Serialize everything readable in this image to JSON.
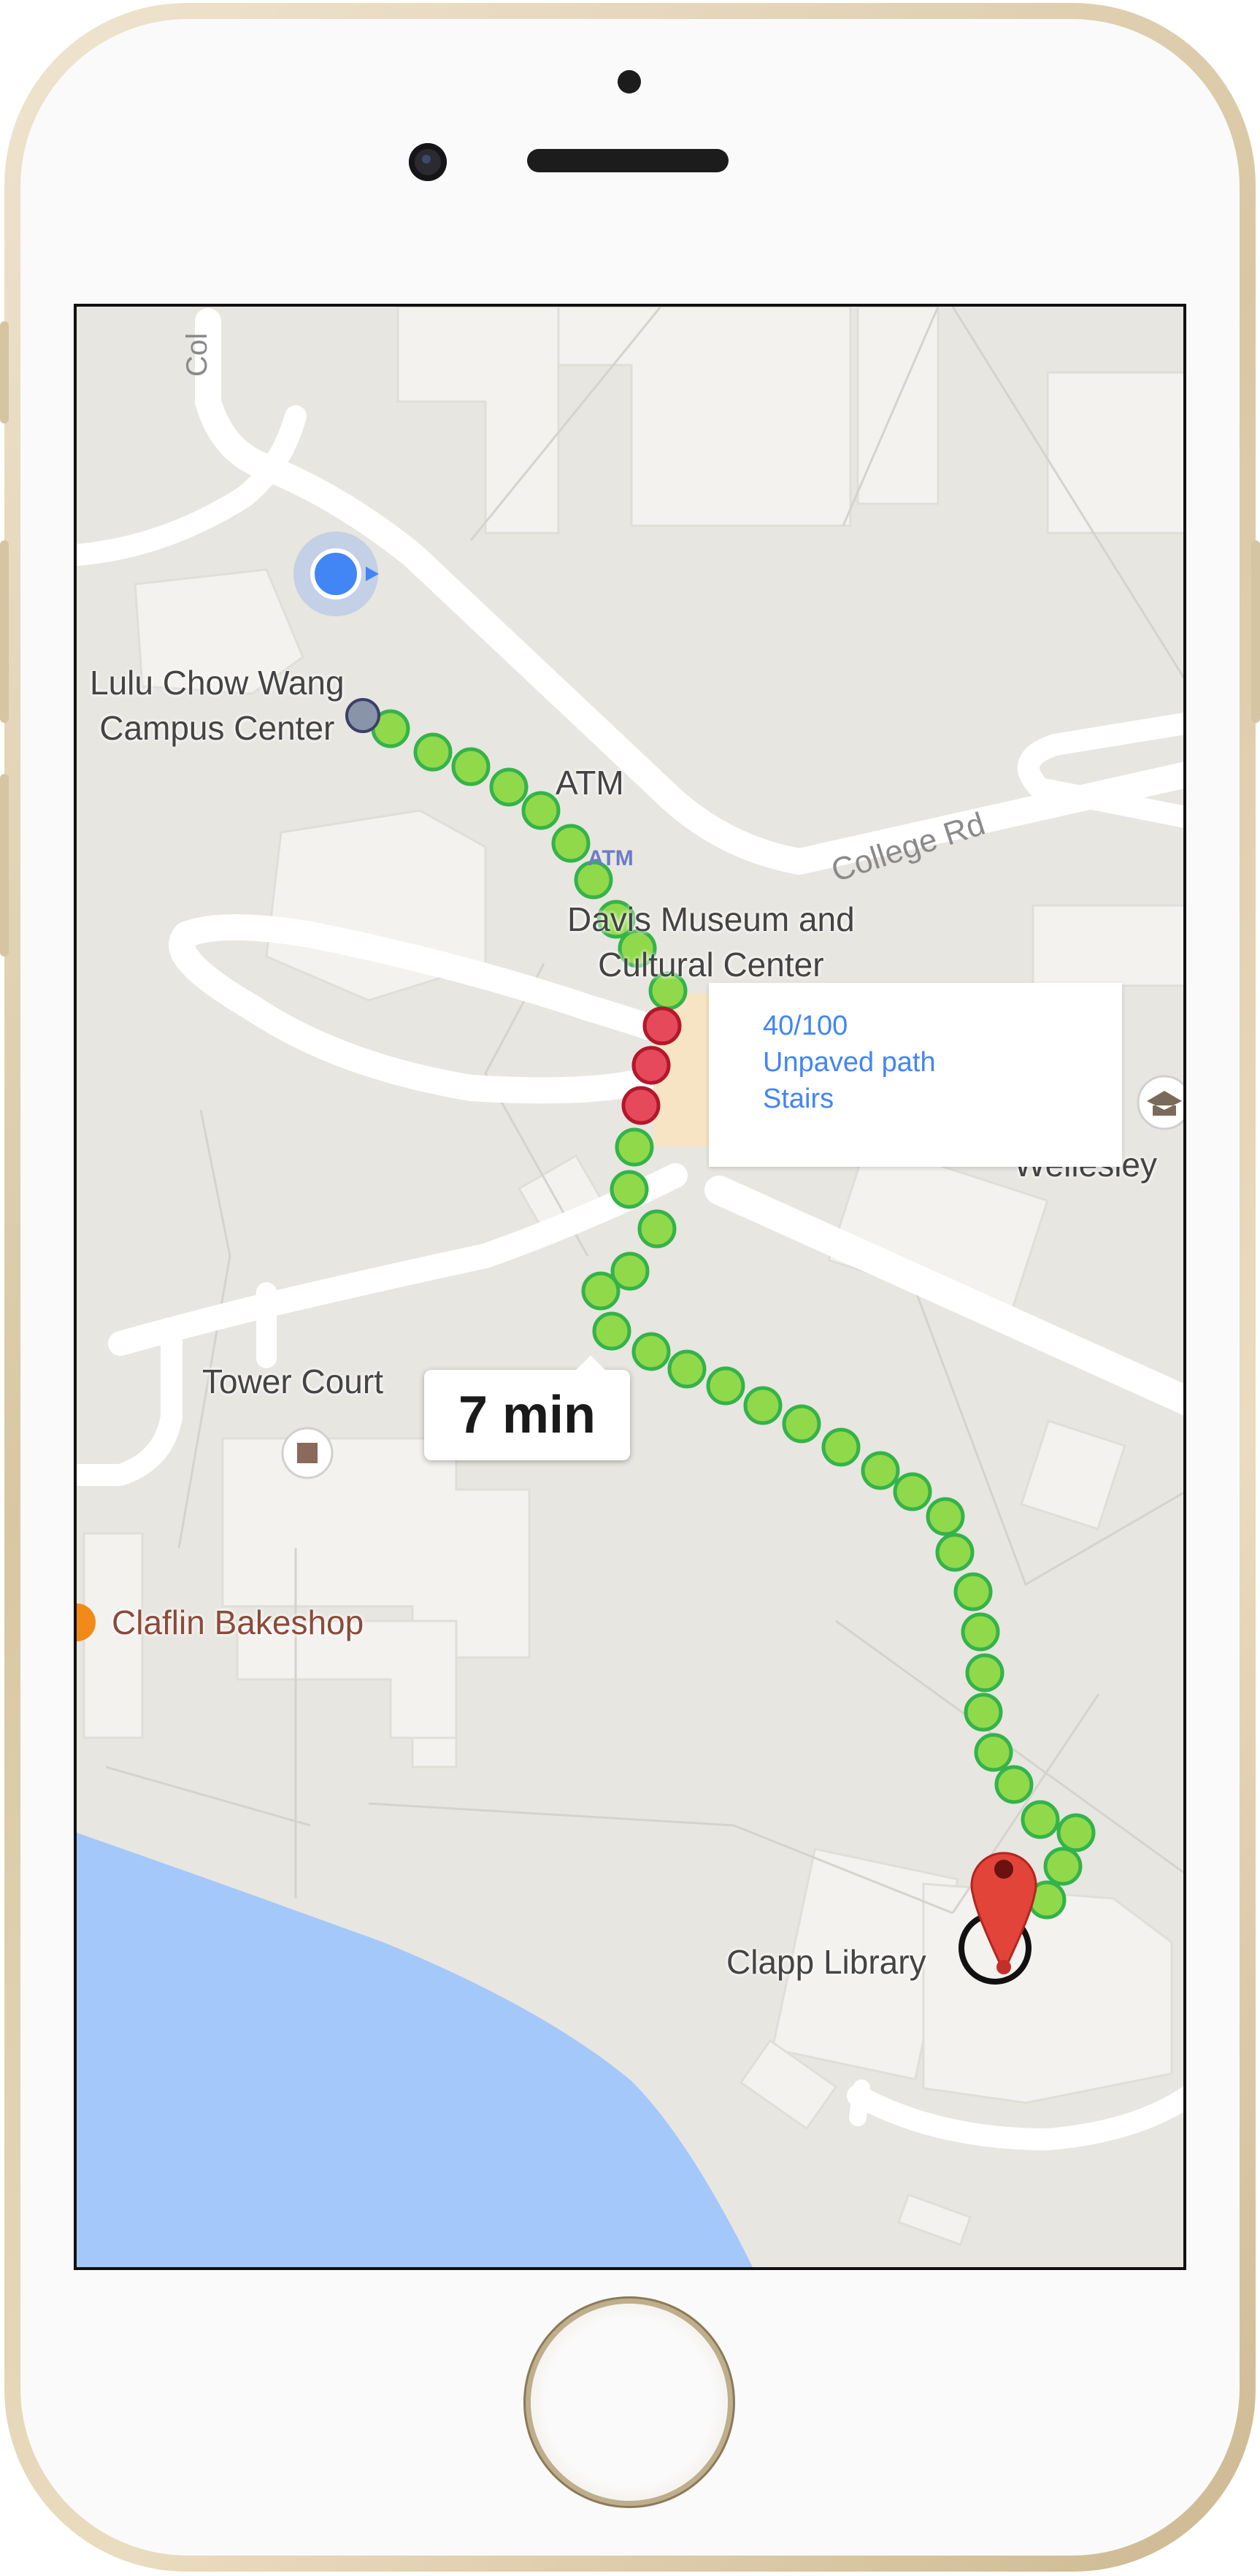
{
  "map": {
    "labels": {
      "campus_center": "Lulu Chow Wang\nCampus Center",
      "campus_center_line1": "Lulu Chow Wang",
      "campus_center_line2": "Campus Center",
      "atm": "ATM",
      "atm_icon_text": "ATM",
      "college_rd": "College Rd",
      "museum_line1": "Davis Museum and",
      "museum_line2": "Cultural Center",
      "wellesley": "Wellesley",
      "tower_court": "Tower Court",
      "claflin": "Claflin Bakeshop",
      "clapp": "Clapp Library",
      "college_partial": "Col"
    },
    "route_popup": {
      "score": "40/100",
      "surface": "Unpaved path",
      "obstacle": "Stairs"
    },
    "eta": "7 min",
    "colors": {
      "route_ok": "#8fd94a",
      "route_ok_border": "#34b34a",
      "route_bad": "#e64a5a",
      "route_bad_border": "#b3172b",
      "water": "#a4c8fa",
      "land": "#e8e6e0",
      "road": "#ffffff",
      "building": "#f2f1ee",
      "location": "#4285f4",
      "pin": "#e2443a"
    }
  },
  "device": {
    "type": "phone"
  }
}
